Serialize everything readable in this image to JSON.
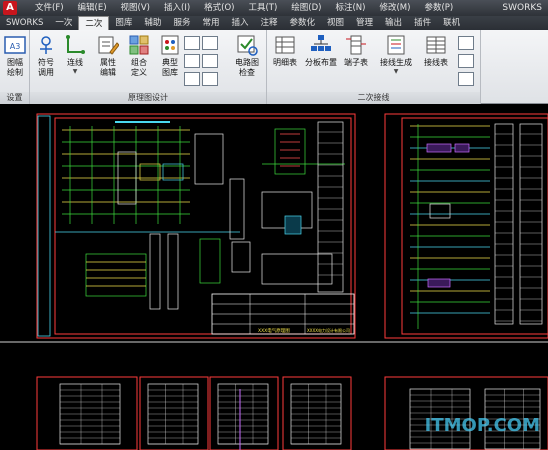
{
  "app": {
    "logo": "A",
    "window_title": "SWORKS"
  },
  "menu": [
    "文件(F)",
    "编辑(E)",
    "视图(V)",
    "插入(I)",
    "格式(O)",
    "工具(T)",
    "绘图(D)",
    "标注(N)",
    "修改(M)",
    "参数(P)"
  ],
  "tabs": [
    "SWORKS",
    "一次",
    "二次",
    "图库",
    "辅助",
    "服务",
    "常用",
    "插入",
    "注释",
    "参数化",
    "视图",
    "管理",
    "输出",
    "插件",
    "联机"
  ],
  "active_tab": "二次",
  "ribbon": {
    "groups": [
      {
        "label": "设置"
      },
      {
        "label": "原理图设计"
      },
      {
        "label": "二次接线"
      }
    ],
    "buttons": {
      "frame": "图幅\n绘制",
      "symbol": "符号\n调用",
      "wire": "连线",
      "attr": "属性\n编辑",
      "combo": "组合\n定义",
      "typical": "典型\n图库",
      "circuit_check": "电路图\n检查",
      "detail": "明细表",
      "distribution": "分板布置",
      "terminal": "端子表",
      "wiring_gen": "接线生成",
      "wiring_table": "接线表"
    }
  },
  "drawing": {
    "title_block_name": "XXX电气原理图",
    "company": "XXXX电力设计有限公司",
    "watermark": "ITMOP.COM"
  },
  "colors": {
    "accent_red": "#c8161d",
    "drawing_bg": "#000000",
    "frame_red": "#ff3b3b",
    "line_green": "#3ddc3d",
    "line_yellow": "#f0e04a",
    "line_cyan": "#4ad8f0"
  }
}
